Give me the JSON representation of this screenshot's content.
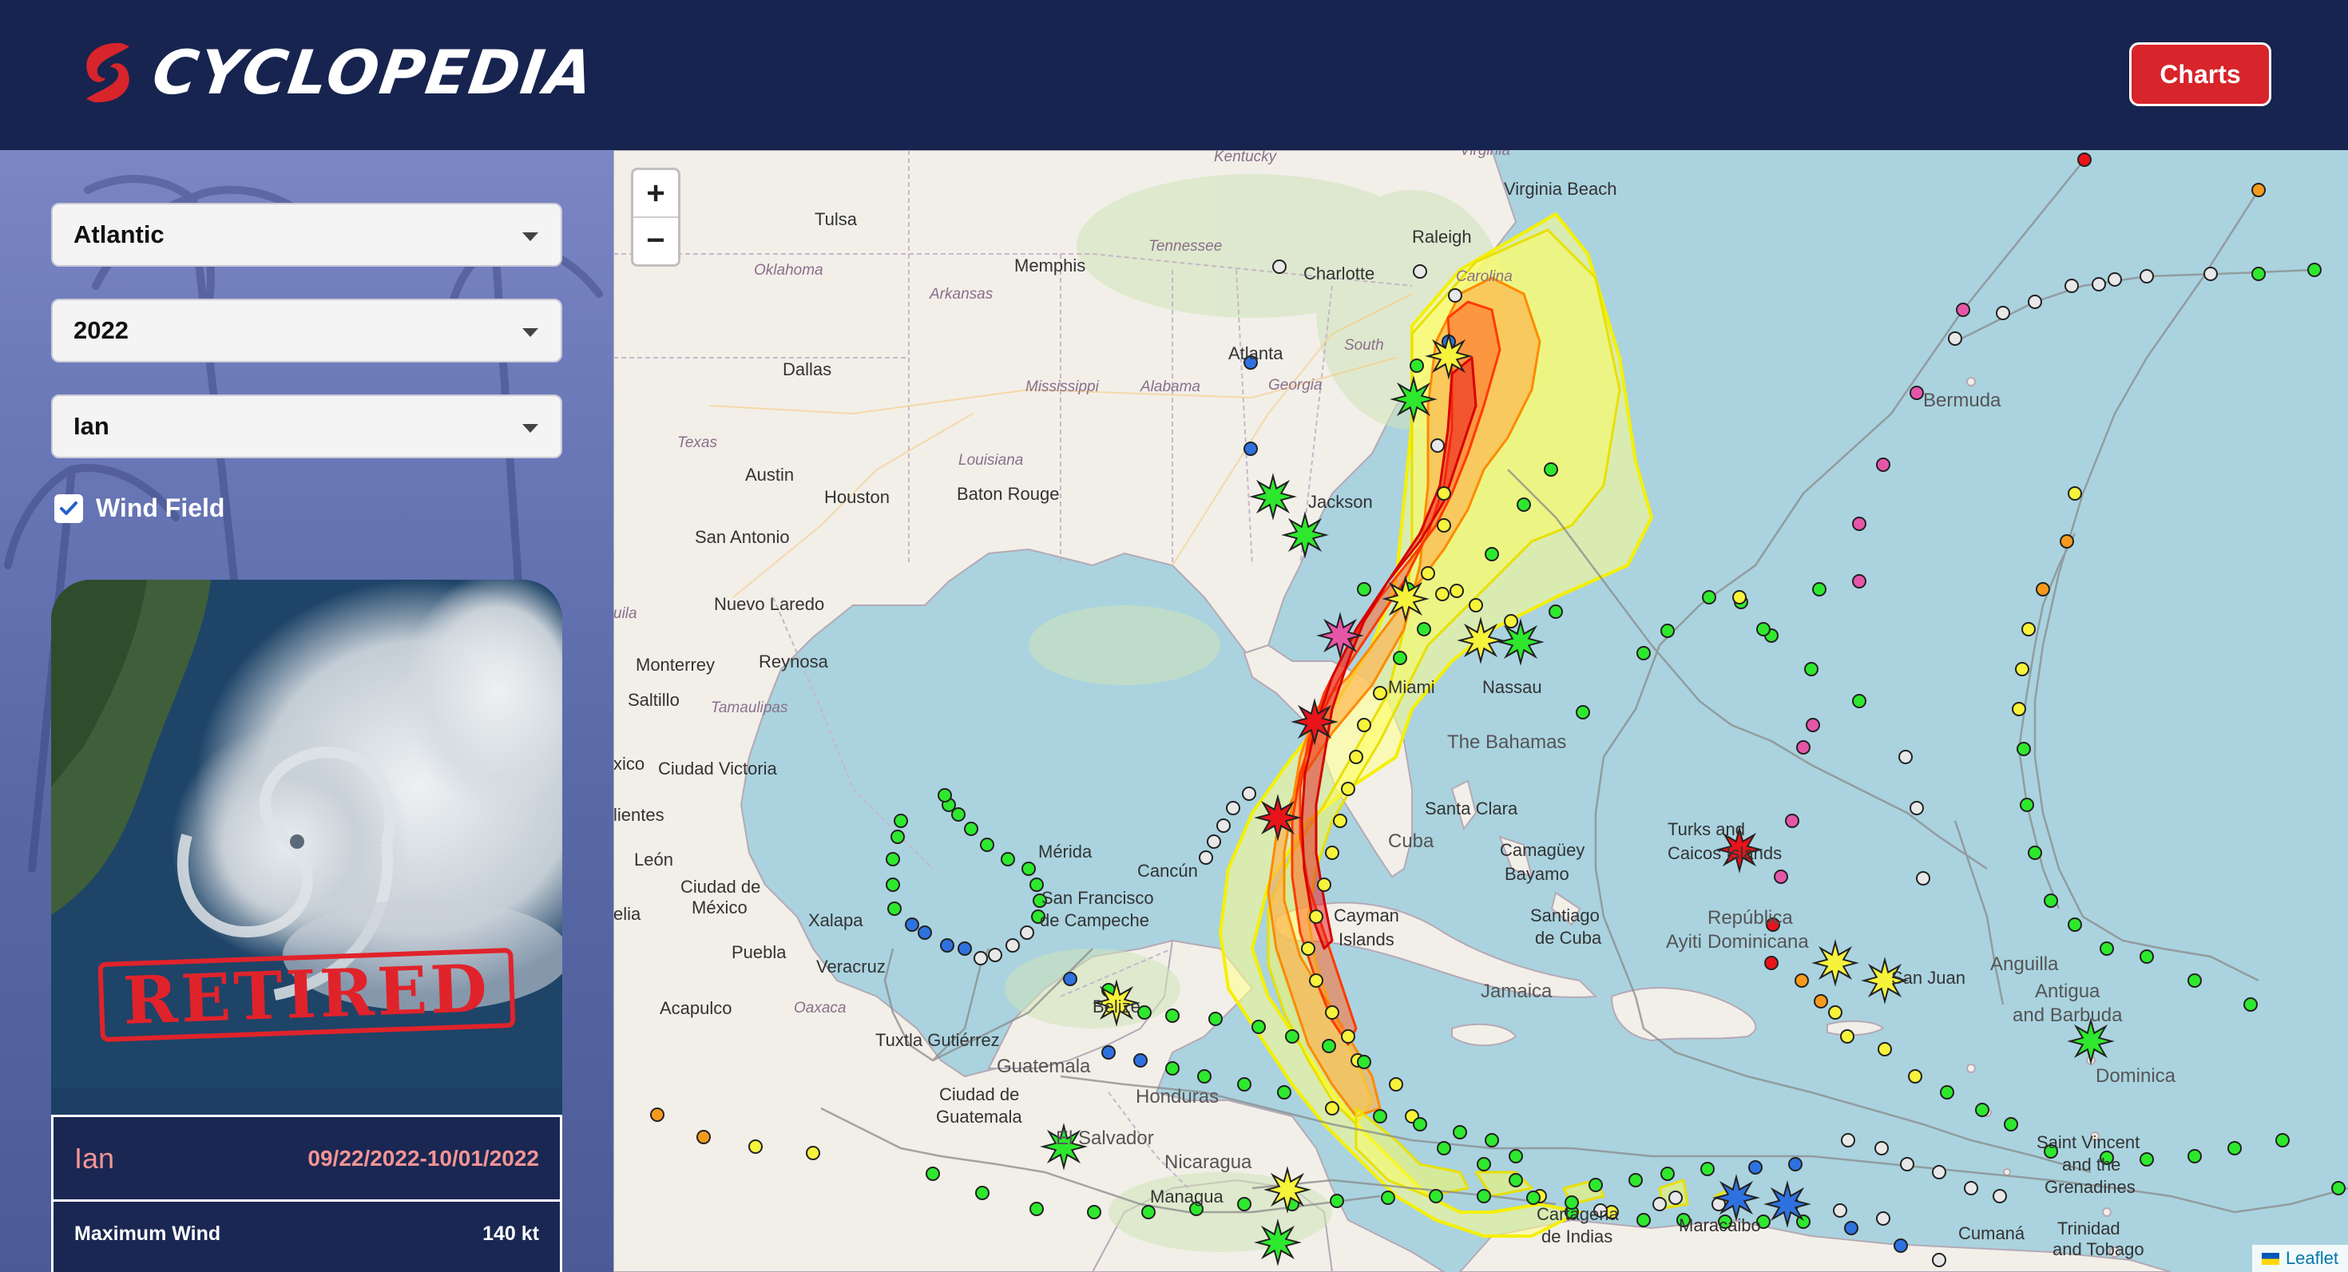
{
  "app": {
    "title": "CYCLOPEDIA",
    "charts_label": "Charts"
  },
  "sidebar": {
    "basin": "Atlantic",
    "year": "2022",
    "storm": "Ian",
    "wind_field_label": "Wind Field",
    "wind_field_checked": true,
    "image_stamp": "RETIRED",
    "info": {
      "name": "Ian",
      "dates": "09/22/2022-10/01/2022",
      "max_wind_label": "Maximum Wind",
      "max_wind_value": "140 kt"
    }
  },
  "map": {
    "zoom_in": "+",
    "zoom_out": "−",
    "attribution": "Leaflet",
    "places": {
      "kentucky": "Kentucky",
      "virginia": "Virginia",
      "virginia_beach": "Virginia Beach",
      "tulsa": "Tulsa",
      "tennessee": "Tennessee",
      "memphis": "Memphis",
      "charlotte": "Charlotte",
      "raleigh": "Raleigh",
      "carolina": "Carolina",
      "oklahoma": "Oklahoma",
      "arkansas": "Arkansas",
      "atlanta": "Atlanta",
      "south": "South",
      "dallas": "Dallas",
      "mississippi": "Mississippi",
      "alabama": "Alabama",
      "georgia": "Georgia",
      "bermuda": "Bermuda",
      "texas": "Texas",
      "louisiana": "Louisiana",
      "austin": "Austin",
      "houston": "Houston",
      "baton_rouge": "Baton Rouge",
      "jackson": "Jackson",
      "san_antonio": "San Antonio",
      "nuevo_laredo": "Nuevo Laredo",
      "huila": "uila",
      "monterrey": "Monterrey",
      "reynosa": "Reynosa",
      "miami": "Miami",
      "nassau": "Nassau",
      "saltillo": "Saltillo",
      "tamaulipas": "Tamaulipas",
      "the_bahamas": "The Bahamas",
      "xico": "xico",
      "ciudad_victoria": "Ciudad Victoria",
      "lientes": "lientes",
      "santa_clara": "Santa Clara",
      "turks": "Turks and",
      "caicos": "Caicos Islands",
      "merida": "Mérida",
      "cuba": "Cuba",
      "camaguey": "Camagüey",
      "bayamo": "Bayamo",
      "leon": "León",
      "cancun": "Cancún",
      "ciudad_de_mexico_1": "Ciudad de",
      "ciudad_de_mexico_2": "México",
      "elia": "elia",
      "xalapa": "Xalapa",
      "san_francisco_1": "San Francisco",
      "san_francisco_2": "de Campeche",
      "cayman_1": "Cayman",
      "cayman_2": "Islands",
      "santiago_1": "Santiago",
      "santiago_2": "de Cuba",
      "republica_1": "República",
      "republica_2": "Dominicana",
      "ayiti": "Ayiti",
      "anguilla": "Anguilla",
      "puebla": "Puebla",
      "veracruz": "Veracruz",
      "san_juan": "San Juan",
      "antigua_1": "Antigua",
      "antigua_2": "and Barbuda",
      "jamaica": "Jamaica",
      "acapulco": "Acapulco",
      "oaxaca": "Oaxaca",
      "belize": "Belize",
      "tuxtla": "Tuxtla Gutiérrez",
      "dominica": "Dominica",
      "guatemala": "Guatemala",
      "ciudad_guatemala_1": "Ciudad de",
      "ciudad_guatemala_2": "Guatemala",
      "honduras": "Honduras",
      "el_salvador": "El Salvador",
      "saint_vincent_1": "Saint Vincent",
      "saint_vincent_2": "and the",
      "saint_vincent_3": "Grenadines",
      "nicaragua": "Nicaragua",
      "managua": "Managua",
      "cartagena_1": "Cartagena",
      "cartagena_2": "de Indias",
      "maracaibo": "Maracaibo",
      "cumana": "Cumaná",
      "trinidad_1": "Trinidad",
      "trinidad_2": "and Tobago"
    }
  }
}
